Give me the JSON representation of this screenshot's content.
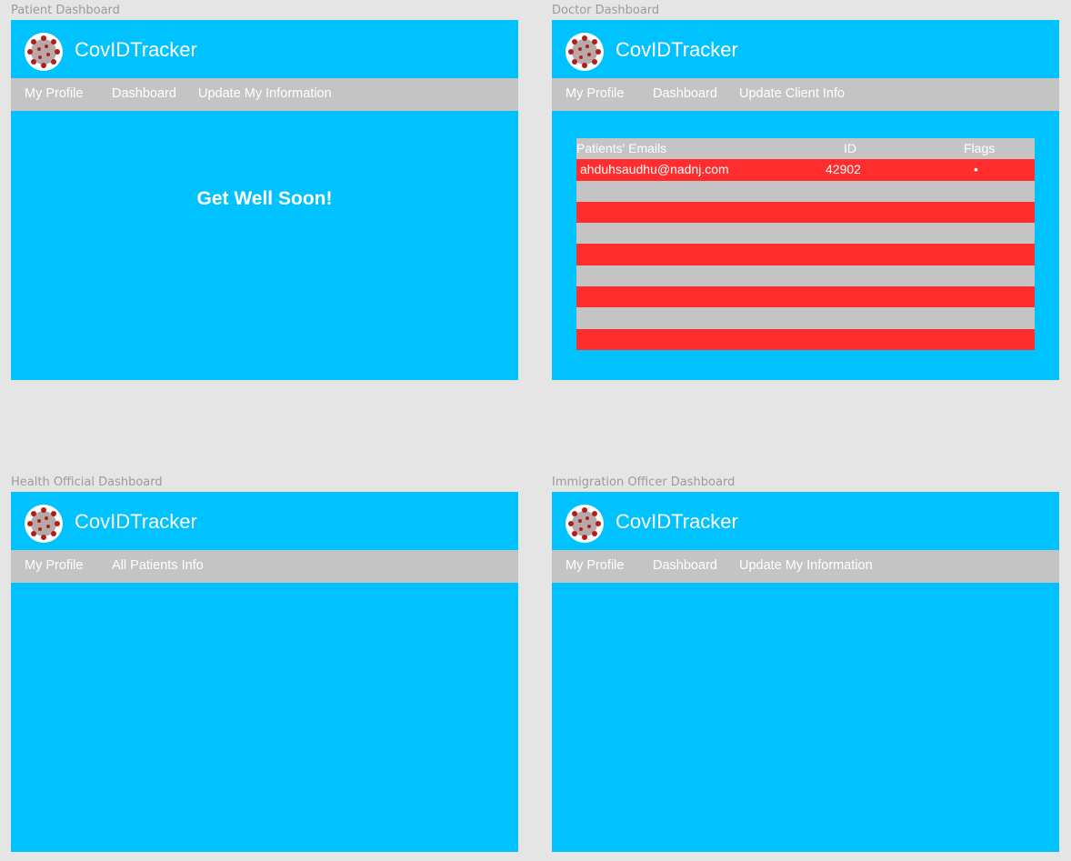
{
  "app": {
    "name": "CovIDTracker"
  },
  "colors": {
    "primary": "#00c2ff",
    "nav": "#c4c4c4",
    "flag_row": "#ff2d2d",
    "canvas": "#e5e5e5"
  },
  "frames": {
    "patient": {
      "label": "Patient Dashboard",
      "nav": [
        "My Profile",
        "Dashboard",
        "Update My Information"
      ],
      "message": "Get Well Soon!"
    },
    "doctor": {
      "label": "Doctor Dashboard",
      "nav": [
        "My Profile",
        "Dashboard",
        "Update Client Info"
      ],
      "table": {
        "headers": [
          "Patients' Emails",
          "ID",
          "Flags"
        ],
        "rows": [
          {
            "email": "ahduhsaudhu@nadnj.com",
            "id": "42902",
            "flag": "•"
          }
        ]
      }
    },
    "health": {
      "label": "Health Official Dashboard",
      "nav": [
        "My Profile",
        "All Patients Info"
      ]
    },
    "immigration": {
      "label": "Immigration Officer Dashboard",
      "nav": [
        "My Profile",
        "Dashboard",
        "Update My Information"
      ]
    }
  }
}
